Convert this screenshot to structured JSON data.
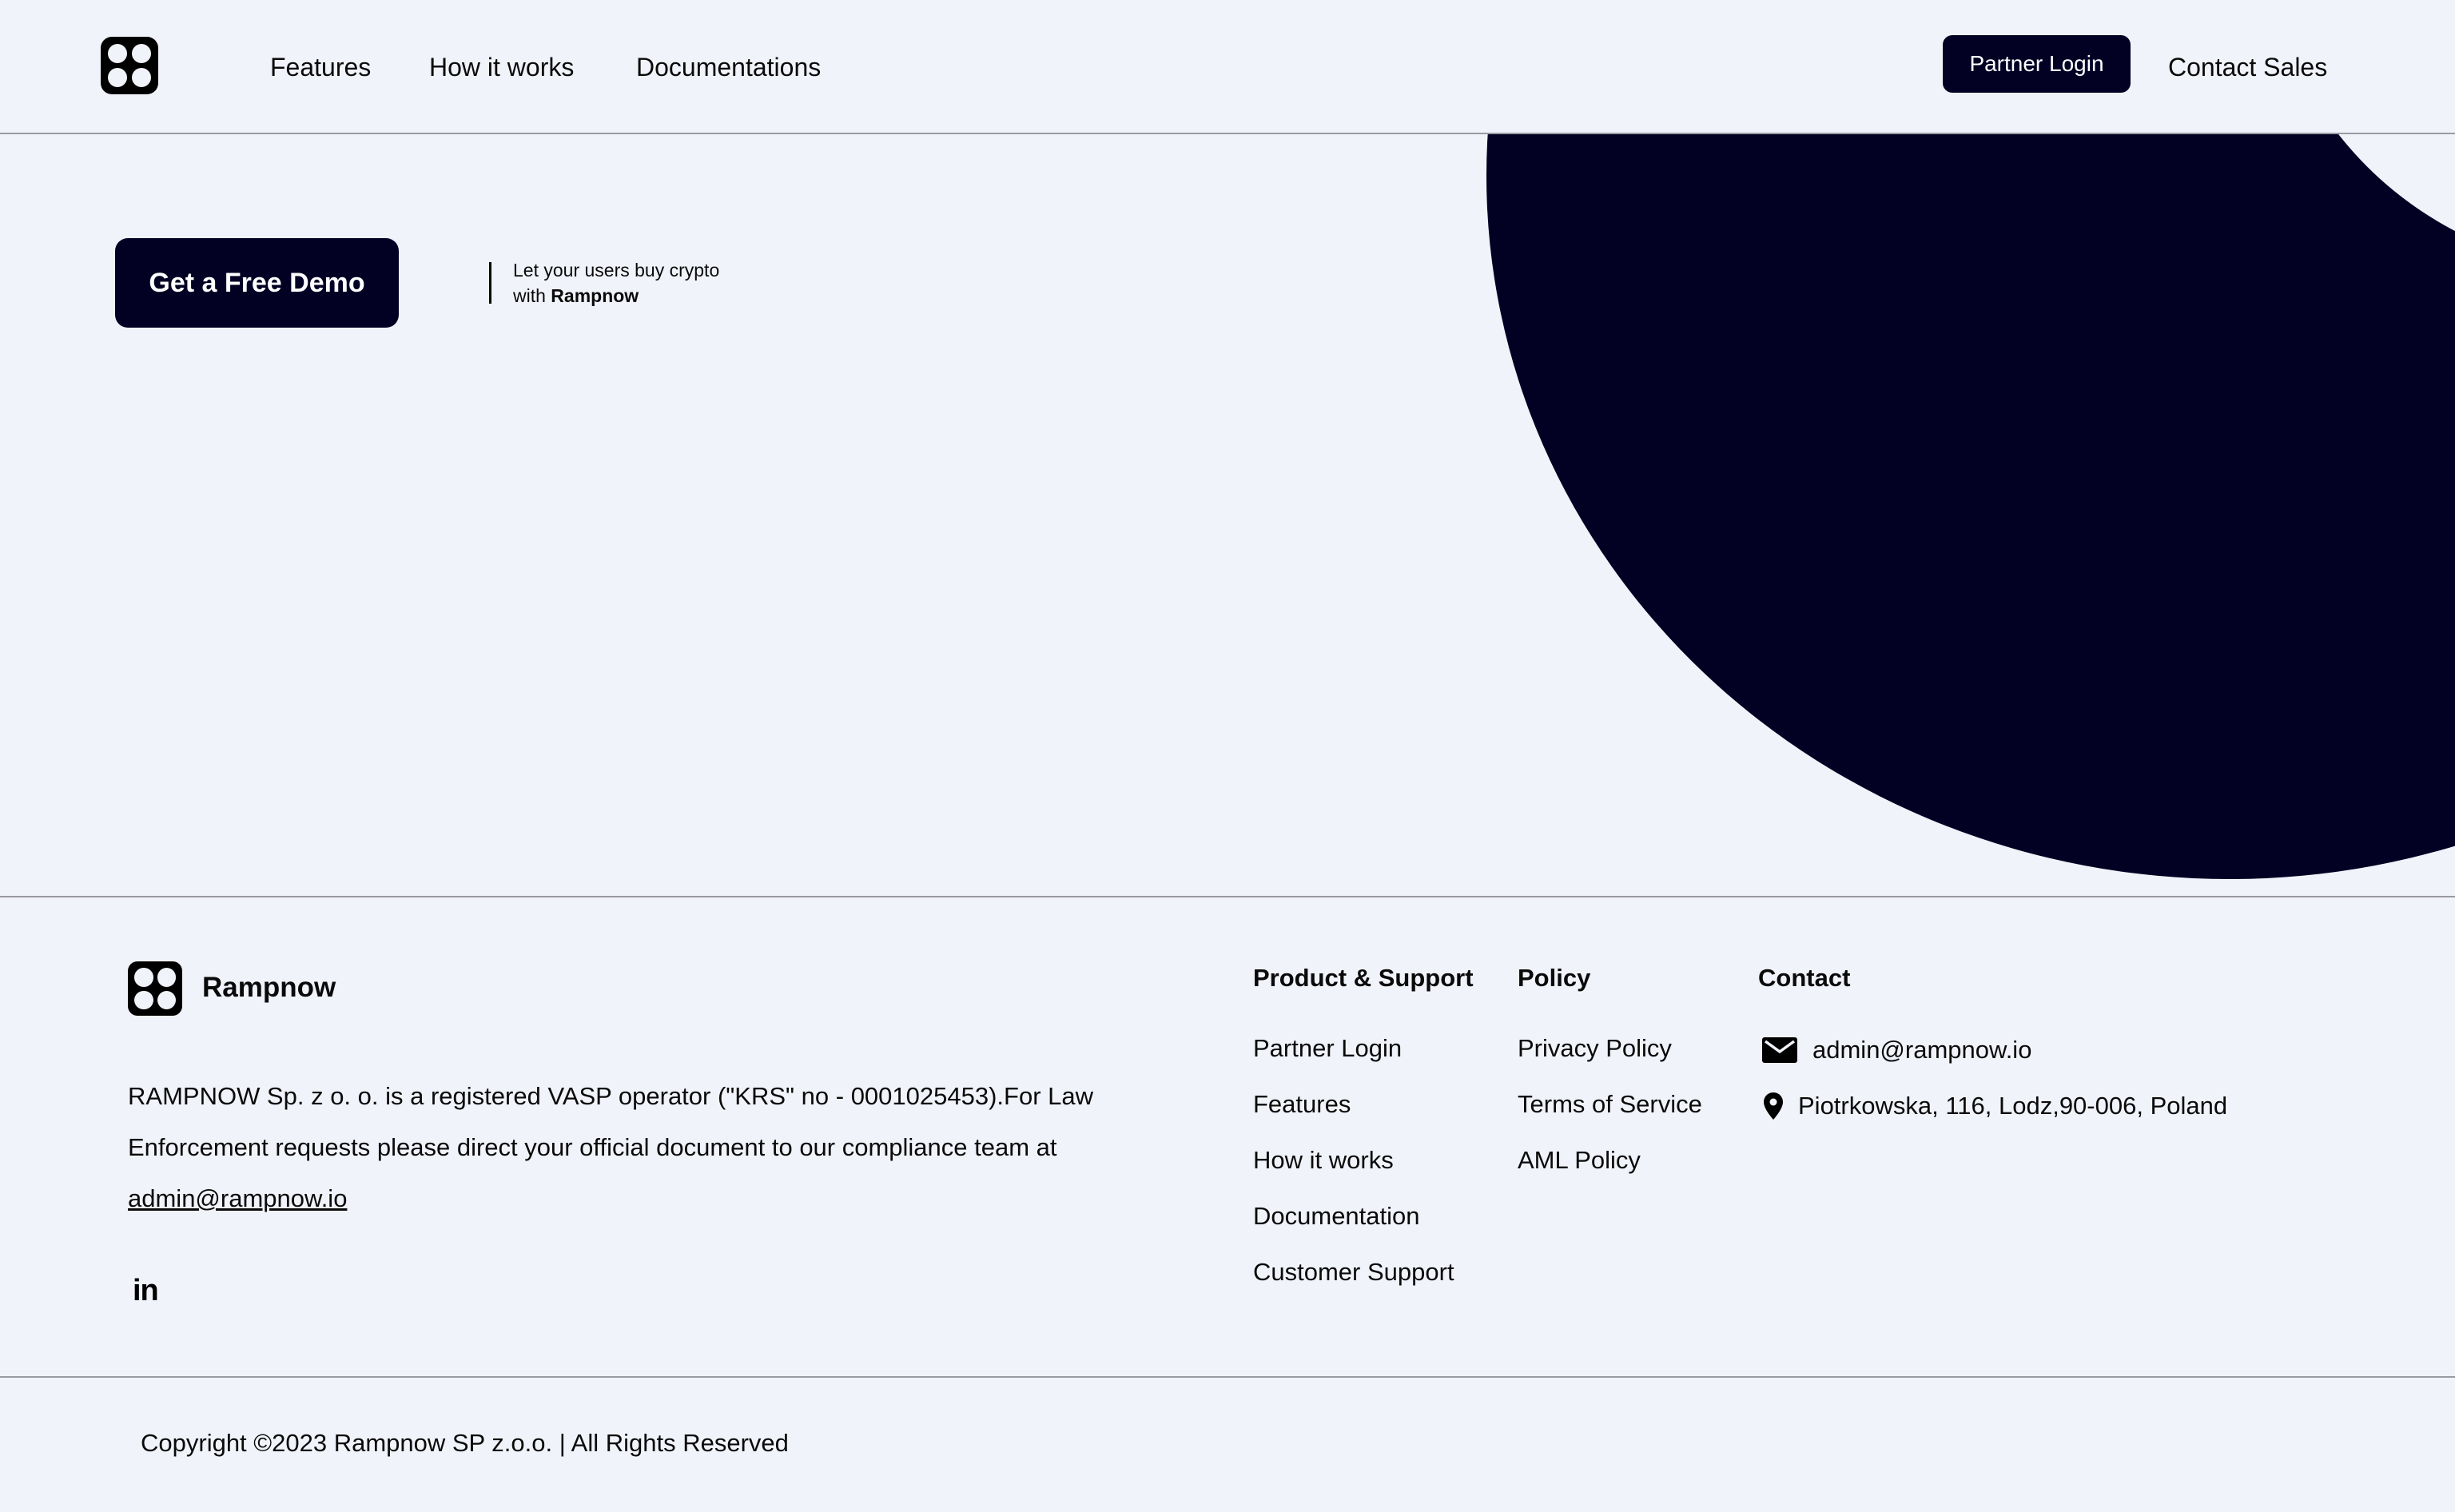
{
  "nav": {
    "links": [
      "Features",
      "How it works",
      "Documentations"
    ],
    "partner_login": "Partner Login",
    "contact_sales": "Contact Sales"
  },
  "hero": {
    "cta": "Get a Free Demo",
    "tagline_line1": "Let your users buy crypto",
    "tagline_prefix": "with ",
    "tagline_brand": "Rampnow"
  },
  "footer": {
    "brand": "Rampnow",
    "about_text": "RAMPNOW Sp. z o. o. is a registered VASP operator (\"KRS\" no - 0001025453).For Law Enforcement requests please direct your official document to our compliance team at ",
    "about_email": "admin@rampnow.io",
    "social_icon": "linkedin-icon",
    "social_text": "in",
    "columns": {
      "product": {
        "heading": "Product & Support",
        "links": [
          "Partner Login",
          "Features",
          "How it works",
          "Documentation",
          "Customer Support"
        ]
      },
      "policy": {
        "heading": "Policy",
        "links": [
          "Privacy Policy",
          "Terms of Service",
          "AML Policy"
        ]
      },
      "contact": {
        "heading": "Contact",
        "email": "admin@rampnow.io",
        "address": "Piotrkowska, 116, Lodz,90-006, Poland"
      }
    },
    "copyright": "Copyright ©2023 Rampnow SP z.o.o. | All Rights Reserved"
  },
  "colors": {
    "background": "#f1f3fa",
    "brand_dark": "#020124",
    "text": "#0a0a0a"
  }
}
